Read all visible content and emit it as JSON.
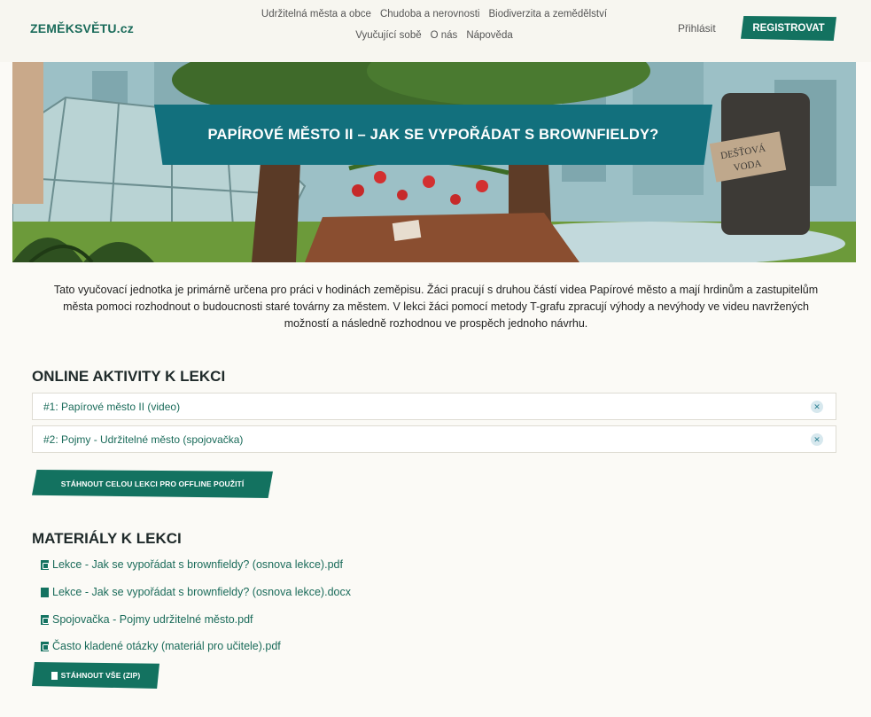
{
  "header": {
    "logo": "ZEMĚKSVĚTU.cz",
    "nav": [
      "Udržitelná města a obce",
      "Chudoba a nerovnosti",
      "Biodiverzita a zemědělství",
      "Vyučující sobě",
      "O nás",
      "Nápověda"
    ],
    "login": "Přihlásit",
    "register": "REGISTROVAT"
  },
  "hero": {
    "title": "PAPÍROVÉ MĚSTO II – JAK SE VYPOŘÁDAT S BROWNFIELDY?",
    "sign_line1": "DEŠŤOVÁ",
    "sign_line2": "VODA"
  },
  "intro": "Tato vyučovací jednotka je primárně určena pro práci v hodinách zeměpisu. Žáci pracují s druhou částí videa Papírové město a mají hrdinům a zastupitelům města pomoci rozhodnout o budoucnosti staré továrny za městem. V lekci žáci pomocí metody T-grafu zpracují výhody a nevýhody ve videu navržených možností a následně rozhodnou ve prospěch jednoho návrhu.",
  "online": {
    "title": "ONLINE AKTIVITY K LEKCI",
    "items": [
      "#1: Papírové město II (video)",
      "#2: Pojmy - Udržitelné město (spojovačka)"
    ],
    "download_button": "STÁHNOUT CELOU LEKCI PRO OFFLINE POUŽITÍ"
  },
  "materials": {
    "title": "MATERIÁLY K LEKCI",
    "items": [
      {
        "label": "Lekce - Jak se vypořádat s brownfieldy? (osnova lekce).pdf",
        "icon": "pdf-icon"
      },
      {
        "label": "Lekce - Jak se vypořádat s brownfieldy? (osnova lekce).docx",
        "icon": "doc-icon"
      },
      {
        "label": "Spojovačka - Pojmy udržitelné město.pdf",
        "icon": "pdf-icon"
      },
      {
        "label": "Často kladené otázky (materiál pro učitele).pdf",
        "icon": "pdf-icon"
      }
    ],
    "zip_button": "STÁHNOUT VŠE (ZIP)"
  },
  "colors": {
    "brand_green": "#137260",
    "banner_teal": "#12707d",
    "link_green": "#1a6b5a",
    "background": "#fbfaf6"
  }
}
